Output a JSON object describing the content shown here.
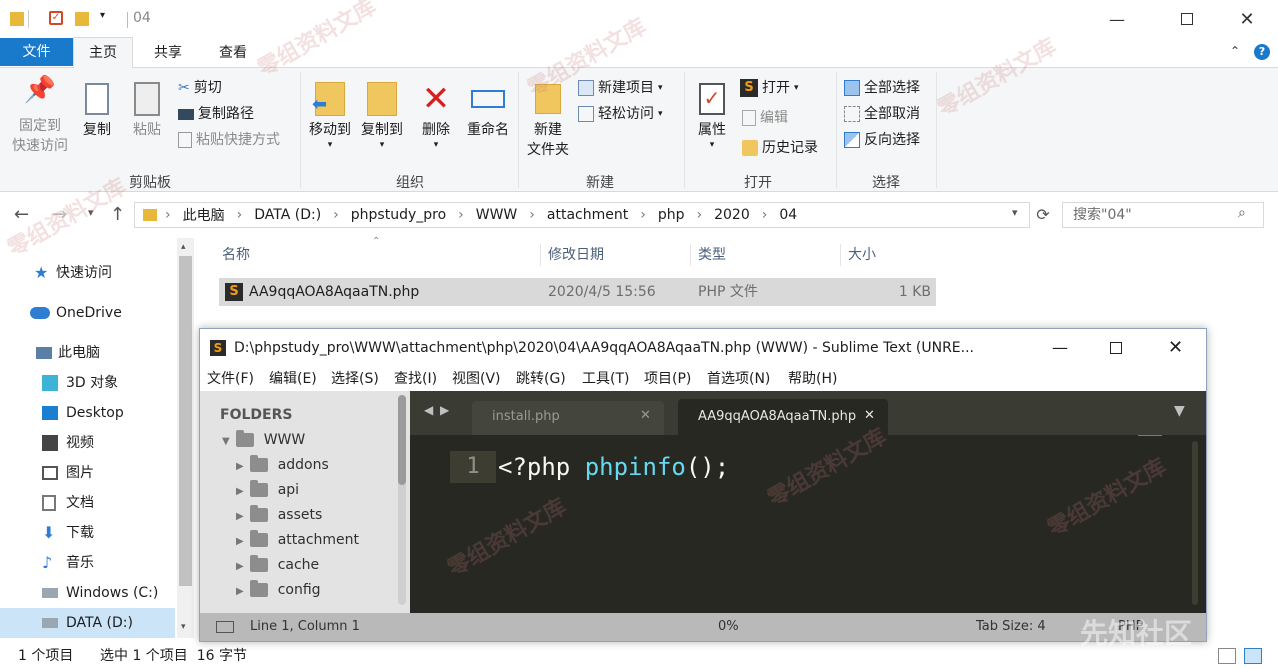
{
  "titlebar": {
    "title": "04"
  },
  "ribbon_tabs": {
    "file": "文件",
    "home": "主页",
    "share": "共享",
    "view": "查看"
  },
  "clipboard": {
    "pin": "固定到\n快速访问",
    "pin_l1": "固定到",
    "pin_l2": "快速访问",
    "copy": "复制",
    "paste": "粘贴",
    "cut": "剪切",
    "copy_path": "复制路径",
    "paste_shortcut": "粘贴快捷方式",
    "label": "剪贴板"
  },
  "organize": {
    "move_to": "移动到",
    "copy_to": "复制到",
    "delete": "删除",
    "rename": "重命名",
    "label": "组织"
  },
  "new": {
    "new_folder_l1": "新建",
    "new_folder_l2": "文件夹",
    "new_item": "新建项目",
    "easy_access": "轻松访问",
    "label": "新建"
  },
  "open": {
    "properties": "属性",
    "open": "打开",
    "edit": "编辑",
    "history": "历史记录",
    "label": "打开"
  },
  "select": {
    "select_all": "全部选择",
    "select_none": "全部取消",
    "invert": "反向选择",
    "label": "选择"
  },
  "address": {
    "crumbs": [
      "此电脑",
      "DATA (D:)",
      "phpstudy_pro",
      "WWW",
      "attachment",
      "php",
      "2020",
      "04"
    ]
  },
  "search": {
    "placeholder": "搜索\"04\""
  },
  "nav": {
    "items": [
      {
        "label": "快速访问"
      },
      {
        "label": "OneDrive"
      },
      {
        "label": "此电脑"
      },
      {
        "label": "3D 对象"
      },
      {
        "label": "Desktop"
      },
      {
        "label": "视频"
      },
      {
        "label": "图片"
      },
      {
        "label": "文档"
      },
      {
        "label": "下载"
      },
      {
        "label": "音乐"
      },
      {
        "label": "Windows (C:)"
      },
      {
        "label": "DATA (D:)"
      }
    ]
  },
  "columns": {
    "name": "名称",
    "date": "修改日期",
    "type": "类型",
    "size": "大小"
  },
  "file": {
    "name": "AA9qqAOA8AqaaTN.php",
    "date": "2020/4/5 15:56",
    "type": "PHP 文件",
    "size": "1 KB"
  },
  "status": {
    "count": "1 个项目",
    "selected": "选中 1 个项目  16 字节"
  },
  "sublime": {
    "title": "D:\\phpstudy_pro\\WWW\\attachment\\php\\2020\\04\\AA9qqAOA8AqaaTN.php (WWW) - Sublime Text (UNRE...",
    "menu": [
      "文件(F)",
      "编辑(E)",
      "选择(S)",
      "查找(I)",
      "视图(V)",
      "跳转(G)",
      "工具(T)",
      "项目(P)",
      "首选项(N)",
      "帮助(H)"
    ],
    "folders_header": "FOLDERS",
    "root": "WWW",
    "folders": [
      "addons",
      "api",
      "assets",
      "attachment",
      "cache",
      "config"
    ],
    "tabs": [
      "install.php",
      "AA9qqAOA8AqaaTN.php"
    ],
    "line_no": "1",
    "code_php": "<?php ",
    "code_fn": "phpinfo",
    "code_rest": "();",
    "status_pos": "Line 1, Column 1",
    "status_pct": "0%",
    "status_tab": "Tab Size: 4",
    "status_syntax": "PHP"
  },
  "watermark": "零组资料文库",
  "watermark2": "先知社区"
}
